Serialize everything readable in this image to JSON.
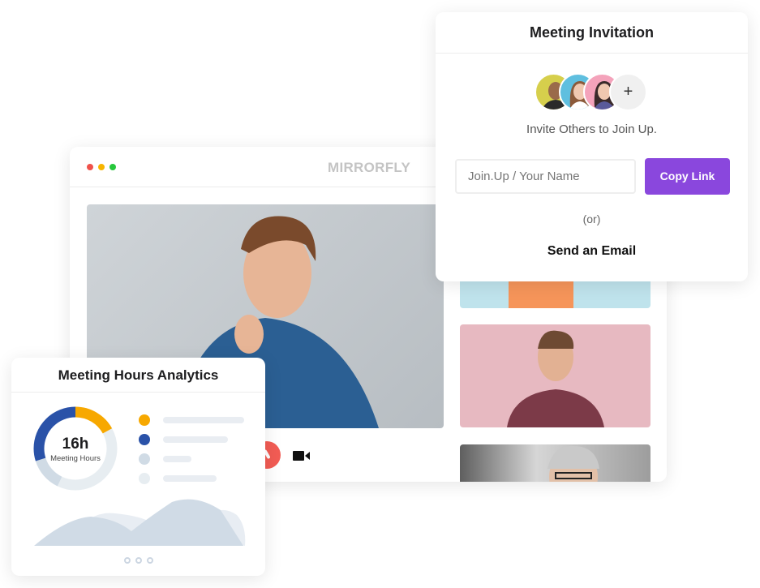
{
  "window": {
    "brand": "MIRRORFLY",
    "dot_colors": [
      "#f0524b",
      "#f7b500",
      "#26c73b"
    ]
  },
  "call_controls": {
    "end_call_icon": "phone-hangup-icon",
    "end_call_color": "#f25c54",
    "video_icon": "video-camera-icon"
  },
  "invitation": {
    "title": "Meeting Invitation",
    "add_label": "+",
    "subtitle": "Invite Others to Join Up.",
    "input_placeholder": "Join.Up / Your Name",
    "copy_button": "Copy Link",
    "or_label": "(or)",
    "email_link": "Send an Email",
    "accent": "#8a47dd"
  },
  "analytics": {
    "title": "Meeting Hours Analytics",
    "donut_value": "16h",
    "donut_label": "Meeting Hours",
    "segments": [
      {
        "percent": 17,
        "color": "#f7a800"
      },
      {
        "percent": 40,
        "color": "#e7edf1"
      },
      {
        "percent": 13,
        "color": "#d0dbe5"
      },
      {
        "percent": 30,
        "color": "#2a52a8"
      }
    ],
    "legend_colors": [
      "#f7a800",
      "#2a52a8",
      "#d0dbe5",
      "#e7edf1"
    ]
  }
}
